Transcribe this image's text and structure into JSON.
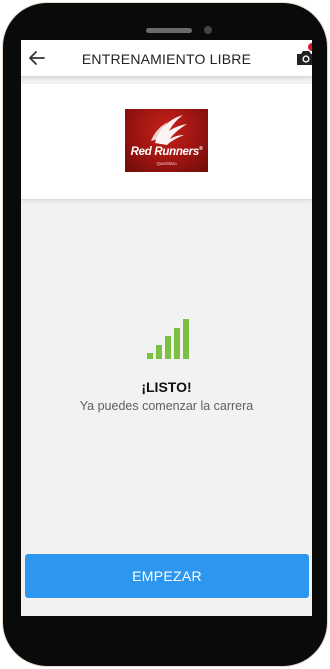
{
  "header": {
    "title": "ENTRENAMIENTO LIBRE",
    "back_icon": "arrow-left-icon",
    "camera_icon": "camera-icon",
    "notification_color": "#e0142b"
  },
  "logo": {
    "brand": "Red Runners",
    "reg_mark": "®",
    "tagline": "Querétaro",
    "background": "#9b1410"
  },
  "status": {
    "icon": "signal-bars-icon",
    "icon_color": "#7ac142",
    "title": "¡LISTO!",
    "subtitle": "Ya puedes comenzar la carrera"
  },
  "actions": {
    "start_label": "EMPEZAR",
    "start_color": "#2d97ef"
  }
}
